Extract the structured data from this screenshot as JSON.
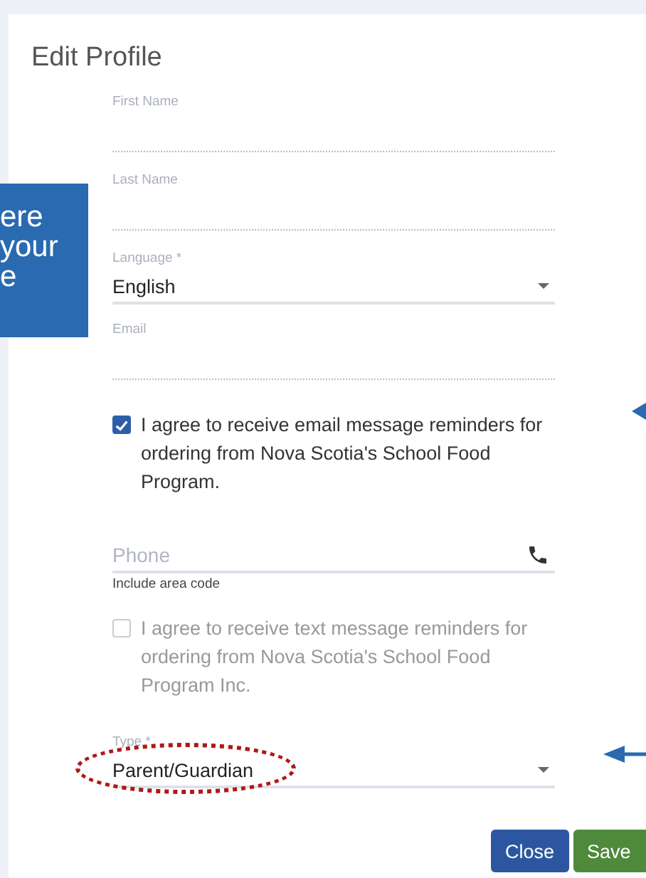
{
  "dialog": {
    "title": "Edit Profile"
  },
  "fields": [
    {
      "kind": "text",
      "label": "First Name",
      "disabled": true
    },
    {
      "kind": "text",
      "label": "Last Name",
      "disabled": true
    },
    {
      "kind": "select",
      "label": "Language *",
      "value": "English"
    },
    {
      "kind": "text",
      "label": "Email",
      "disabled": true
    },
    {
      "kind": "checkbox",
      "text": "I agree to receive email message reminders for ordering from Nova Scotia's School Food Program.",
      "checked": true,
      "disabled": false
    },
    {
      "kind": "phone",
      "placeholder": "Phone",
      "hint": "Include area code"
    },
    {
      "kind": "checkbox",
      "text": "I agree to receive text message reminders for ordering from Nova Scotia's School Food Program Inc.",
      "checked": false,
      "disabled": true
    },
    {
      "kind": "select",
      "label": "Type *",
      "value": "Parent/Guardian",
      "circled": true
    }
  ],
  "buttons": [
    {
      "label": "Close",
      "kind": "primary"
    },
    {
      "label": "Save",
      "kind": "success"
    }
  ],
  "callout": {
    "lines": [
      "ere",
      "your",
      "e"
    ]
  }
}
